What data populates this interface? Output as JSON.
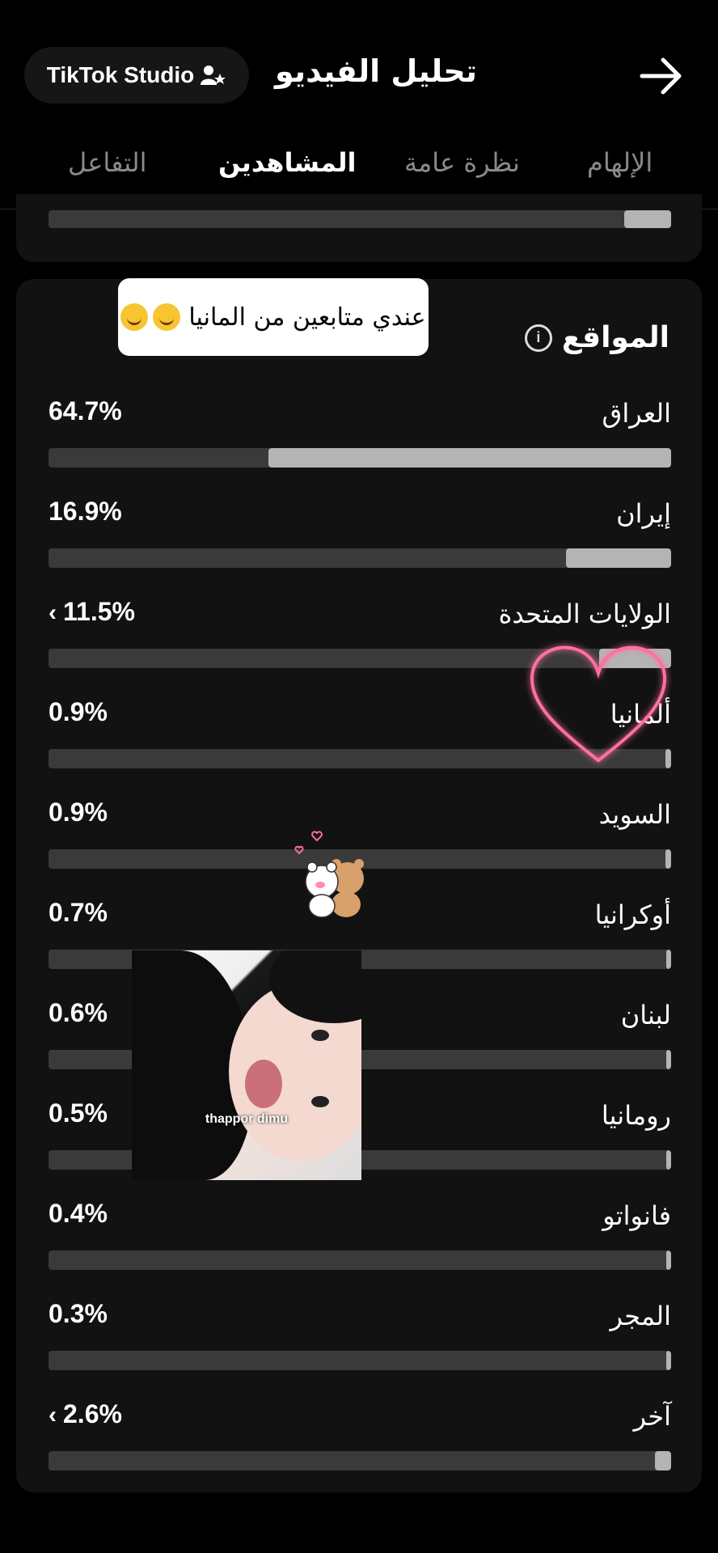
{
  "header": {
    "studio_label": "TikTok Studio",
    "title": "تحليل الفيديو"
  },
  "tabs": [
    {
      "label": "الإلهام"
    },
    {
      "label": "نظرة عامة"
    },
    {
      "label": "المشاهدين"
    },
    {
      "label": "التفاعل"
    }
  ],
  "active_tab": "المشاهدين",
  "previous_section": {
    "last_bar_fraction": 0.075
  },
  "locations": {
    "title": "المواقع",
    "rows": [
      {
        "country": "العراق",
        "percent": "64.7%",
        "value": 64.7,
        "has_chevron": false
      },
      {
        "country": "إيران",
        "percent": "16.9%",
        "value": 16.9,
        "has_chevron": false
      },
      {
        "country": "الولايات المتحدة",
        "percent": "11.5%",
        "value": 11.5,
        "has_chevron": true
      },
      {
        "country": "ألمانيا",
        "percent": "0.9%",
        "value": 0.9,
        "has_chevron": false
      },
      {
        "country": "السويد",
        "percent": "0.9%",
        "value": 0.9,
        "has_chevron": false
      },
      {
        "country": "أوكرانيا",
        "percent": "0.7%",
        "value": 0.7,
        "has_chevron": false
      },
      {
        "country": "لبنان",
        "percent": "0.6%",
        "value": 0.6,
        "has_chevron": false
      },
      {
        "country": "رومانيا",
        "percent": "0.5%",
        "value": 0.5,
        "has_chevron": false
      },
      {
        "country": "فانواتو",
        "percent": "0.4%",
        "value": 0.4,
        "has_chevron": false
      },
      {
        "country": "المجر",
        "percent": "0.3%",
        "value": 0.3,
        "has_chevron": false
      },
      {
        "country": "آخر",
        "percent": "2.6%",
        "value": 2.6,
        "has_chevron": true
      }
    ]
  },
  "overlay": {
    "comment_text": "عندي متابعين من المانيا",
    "photo_caption": "thappor dimu"
  },
  "colors": {
    "background": "#000000",
    "card": "#121212",
    "bar_track": "#3a3a3a",
    "bar_fill": "#b4b4b4",
    "heart": "#ff6fa0"
  }
}
